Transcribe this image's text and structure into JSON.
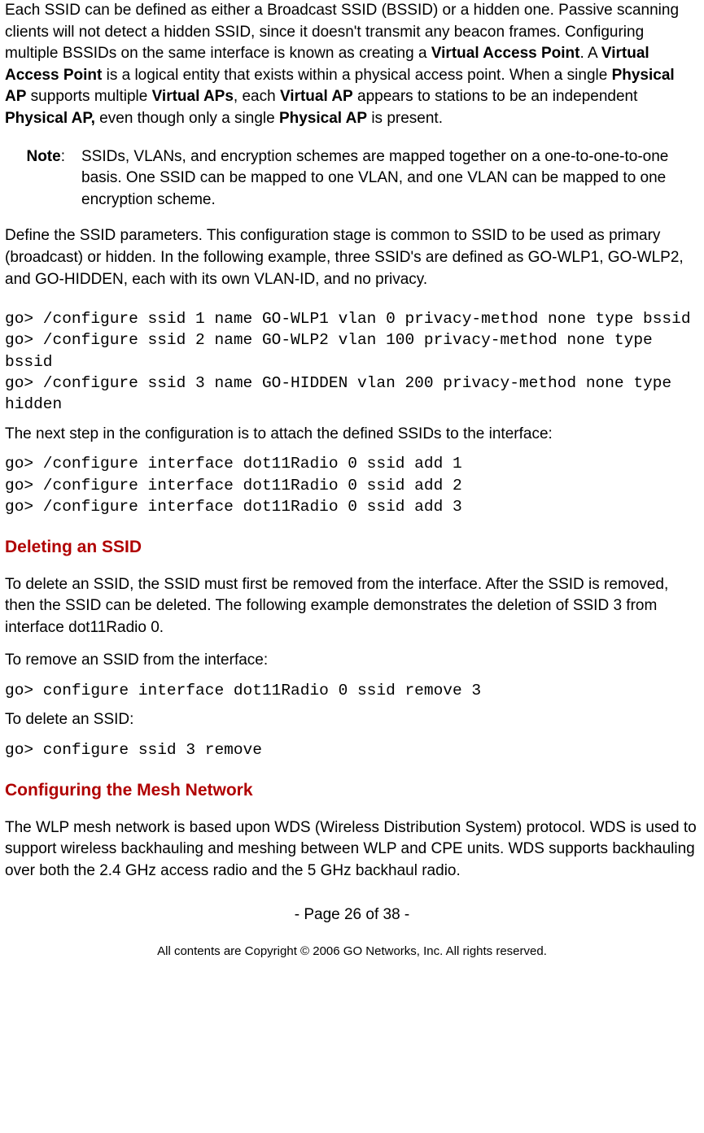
{
  "intro": {
    "p1_a": "Each SSID can be defined as either a Broadcast SSID (BSSID) or a hidden one. Passive scanning clients will not detect a hidden SSID, since it doesn't transmit any beacon frames. Configuring multiple BSSIDs on the same interface is known as creating a ",
    "b1": "Virtual Access Point",
    "p1_b": ". A ",
    "b2": "Virtual Access Point",
    "p1_c": " is a logical entity that exists within a physical access point. When a single ",
    "b3": "Physical AP",
    "p1_d": " supports multiple ",
    "b4": "Virtual APs",
    "p1_e": ", each ",
    "b5": "Virtual AP",
    "p1_f": " appears to stations to be an independent ",
    "b6": "Physical AP,",
    "p1_g": " even though only a single ",
    "b7": "Physical AP",
    "p1_h": " is present."
  },
  "note": {
    "label": "Note",
    "colon": ":",
    "body": "SSIDs, VLANs, and encryption schemes are mapped together on a one-to-one-to-one basis. One SSID can be mapped to one VLAN, and one VLAN can be mapped to one encryption scheme."
  },
  "define": {
    "p": "Define the SSID parameters. This configuration stage is common to SSID to be used as primary (broadcast) or hidden. In the following example, three SSID's are defined as GO-WLP1, GO-WLP2, and GO-HIDDEN, each with its own VLAN-ID, and no privacy."
  },
  "code1": "go> /configure ssid 1 name GO-WLP1 vlan 0 privacy-method none type bssid\ngo> /configure ssid 2 name GO-WLP2 vlan 100 privacy-method none type bssid\ngo> /configure ssid 3 name GO-HIDDEN vlan 200 privacy-method none type hidden",
  "attach": {
    "p": "The next step in the configuration is to attach the defined SSIDs to the interface:"
  },
  "code2": "go> /configure interface dot11Radio 0 ssid add 1\ngo> /configure interface dot11Radio 0 ssid add 2\ngo> /configure interface dot11Radio 0 ssid add 3",
  "h_delete": "Deleting an SSID",
  "delete": {
    "p1": "To delete an SSID, the SSID must first be removed from the interface. After the SSID is removed, then the SSID can be deleted. The following example demonstrates the deletion of SSID 3 from interface dot11Radio 0.",
    "p2": "To remove an SSID from the interface:",
    "code1": "go> configure interface dot11Radio 0 ssid remove 3",
    "p3": "To delete an SSID:",
    "code2": "go> configure ssid 3 remove"
  },
  "h_mesh": "Configuring the Mesh Network",
  "mesh": {
    "p": "The WLP mesh network is based upon WDS (Wireless Distribution System) protocol. WDS is used to support wireless backhauling and meshing between WLP and CPE units. WDS supports backhauling over both the 2.4 GHz access radio and the 5 GHz backhaul radio."
  },
  "footer": {
    "page": "- Page 26 of 38 -",
    "copyright": "All contents are Copyright © 2006 GO Networks, Inc. All rights reserved."
  }
}
